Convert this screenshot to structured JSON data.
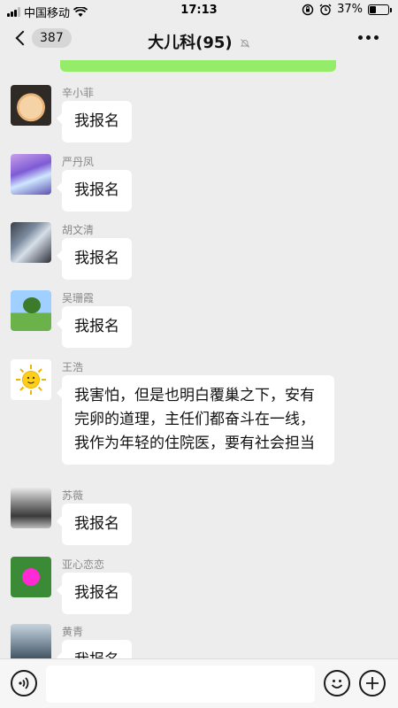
{
  "status_bar": {
    "carrier": "中国移动",
    "time": "17:13",
    "battery_percent": "37%",
    "battery_level": 0.37
  },
  "nav": {
    "back_count": "387",
    "title": "大儿科(95)"
  },
  "messages": [
    {
      "sender": "辛小菲",
      "text": "我报名",
      "avatar": "baby-photo"
    },
    {
      "sender": "严丹凤",
      "text": "我报名",
      "avatar": "purple-scenery"
    },
    {
      "sender": "胡文清",
      "text": "我报名",
      "avatar": "statue-photo"
    },
    {
      "sender": "吴珊霞",
      "text": "我报名",
      "avatar": "tree-field"
    },
    {
      "sender": "王浩",
      "text": "我害怕，但是也明白覆巢之下，安有完卵的道理，主任们都奋斗在一线，我作为年轻的住院医，要有社会担当",
      "avatar": "sun-emoji"
    },
    {
      "sender": "苏薇",
      "text": "我报名",
      "avatar": "gate-photo"
    },
    {
      "sender": "亚心恋恋",
      "text": "我报名",
      "avatar": "pink-flower"
    },
    {
      "sender": "黄青",
      "text": "我报名",
      "avatar": "willow-tree"
    }
  ],
  "input": {
    "placeholder": ""
  },
  "icons": {
    "back": "chevron-left-icon",
    "mute": "bell-muted-icon",
    "more": "more-dots-icon",
    "voice": "voice-icon",
    "emoji": "emoji-icon",
    "plus": "plus-icon"
  },
  "colors": {
    "background": "#ededed",
    "bubble_self": "#95ec69",
    "bubble_other": "#ffffff"
  }
}
